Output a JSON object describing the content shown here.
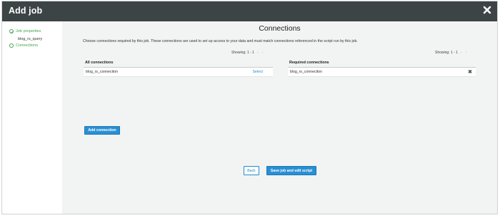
{
  "window": {
    "title": "Add job",
    "close_icon": "close-icon"
  },
  "sidebar": {
    "steps": [
      {
        "label": "Job properties",
        "status": "completed",
        "sub": "blog_rs_query"
      },
      {
        "label": "Connections",
        "status": "active"
      }
    ]
  },
  "main": {
    "heading": "Connections",
    "description": "Choose connections required by this job. These connections are used to set up access to your data and must match connections referenced in the script run by this job.",
    "all_connections": {
      "header": "All connections",
      "showing": "Showing: 1 - 1",
      "rows": [
        {
          "name": "blog_rs_conneciton",
          "action": "Select"
        }
      ]
    },
    "required_connections": {
      "header": "Required connections",
      "showing": "Showing: 1 - 1",
      "rows": [
        {
          "name": "blog_rs_conneciton",
          "remove_icon": "remove-icon"
        }
      ]
    },
    "add_connection_label": "Add connection",
    "back_label": "Back",
    "save_label": "Save job and edit script"
  },
  "colors": {
    "accent": "#2a8fd4",
    "titlebar": "#3d4446",
    "success": "#3ea648",
    "content_bg": "#f2f3f3"
  }
}
